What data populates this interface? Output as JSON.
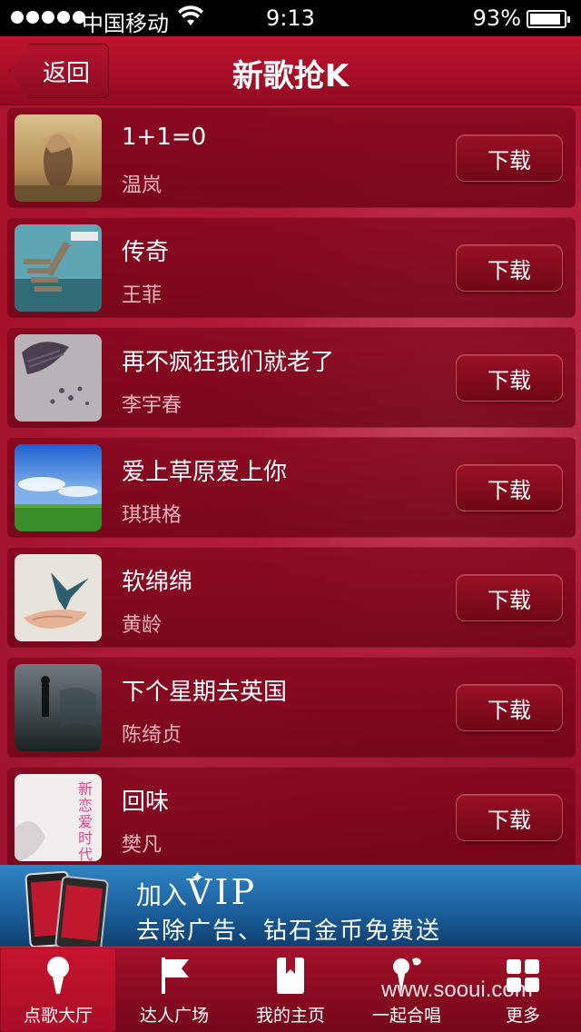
{
  "status_bar": {
    "carrier": "中国移动",
    "time": "9:13",
    "battery_percent": "93%",
    "battery_level": 0.93
  },
  "nav": {
    "back_label": "返回",
    "title": "新歌抢K"
  },
  "songs": [
    {
      "title": "1+1=0",
      "artist": "温岚",
      "download_label": "下载",
      "thumb_icon": "desert-girl-cover"
    },
    {
      "title": "传奇",
      "artist": "王菲",
      "download_label": "下载",
      "thumb_icon": "pier-cover"
    },
    {
      "title": "再不疯狂我们就老了",
      "artist": "李宇春",
      "download_label": "下载",
      "thumb_icon": "sculpture-cover"
    },
    {
      "title": "爱上草原爱上你",
      "artist": "琪琪格",
      "download_label": "下载",
      "thumb_icon": "grassland-cover"
    },
    {
      "title": "软绵绵",
      "artist": "黄龄",
      "download_label": "下载",
      "thumb_icon": "bird-hand-cover"
    },
    {
      "title": "下个星期去英国",
      "artist": "陈绮贞",
      "download_label": "下载",
      "thumb_icon": "dark-figure-cover"
    },
    {
      "title": "回味",
      "artist": "樊凡",
      "download_label": "下载",
      "thumb_icon": "new-love-era-cover",
      "thumb_text": "新恋爱时代"
    }
  ],
  "banner": {
    "headline_prefix": "加入",
    "headline_vip": "VIP",
    "subline": "去除广告、钻石金币免费送"
  },
  "tabs": [
    {
      "label": "点歌大厅",
      "icon": "microphone-icon",
      "active": true
    },
    {
      "label": "达人广场",
      "icon": "flag-icon",
      "active": false
    },
    {
      "label": "我的主页",
      "icon": "bookmark-book-icon",
      "active": false
    },
    {
      "label": "一起合唱",
      "icon": "duet-microphone-icon",
      "active": false
    },
    {
      "label": "更多",
      "icon": "grid-icon",
      "active": false
    }
  ],
  "watermark": "www.sooui.com",
  "colors": {
    "background": "#9d0f28",
    "navbar": "#a70f27",
    "banner": "#1a5d99",
    "tabbar": "#8a0b21"
  }
}
